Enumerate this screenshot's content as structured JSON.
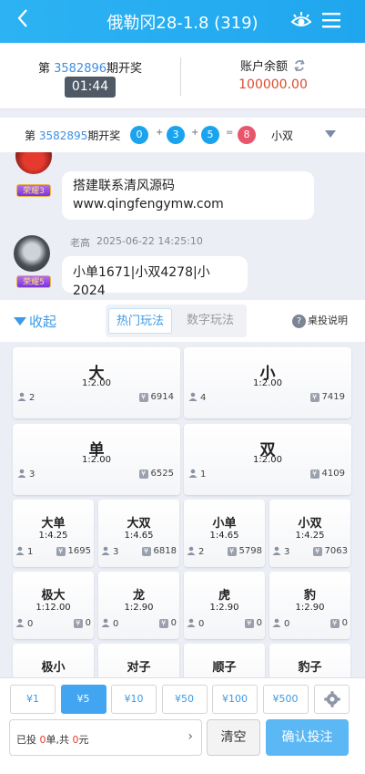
{
  "header": {
    "title": "俄勒冈28-1.8 (319)",
    "back_icon": "chevron-left-icon",
    "eye_icon": "eye-icon",
    "menu_icon": "menu-icon"
  },
  "draw": {
    "prefix": "第 ",
    "period": "3582896",
    "suffix": "期开奖",
    "countdown": "01:44",
    "balance_label": "账户余额",
    "balance": "100000.00"
  },
  "last_result": {
    "prefix": "第 ",
    "period": "3582895",
    "suffix": "期开奖",
    "balls": [
      "0",
      "3",
      "5",
      "8"
    ],
    "ball_colors": [
      "#1aa4ef",
      "#1aa4ef",
      "#1aa4ef",
      "#e8566c"
    ],
    "ops": [
      "+",
      "+",
      "="
    ],
    "kind": "小双"
  },
  "chat": {
    "messages": [
      {
        "rank": "荣耀3",
        "text_line1": "搭建联系清风源码",
        "text_line2": "www.qingfengymw.com"
      },
      {
        "user": "老高",
        "time": "2025-06-22 14:25:10",
        "rank": "荣耀5",
        "text": "小单1671|小双4278|小2024"
      }
    ]
  },
  "tabs": {
    "collapse": "收起",
    "items": [
      "热门玩法",
      "数字玩法"
    ],
    "help": "桌投说明"
  },
  "bets": [
    {
      "name": "大",
      "odds": "1:2.00",
      "players": "2",
      "amount": "6914"
    },
    {
      "name": "小",
      "odds": "1:2.00",
      "players": "4",
      "amount": "7419"
    },
    {
      "name": "单",
      "odds": "1:2.00",
      "players": "3",
      "amount": "6525"
    },
    {
      "name": "双",
      "odds": "1:2.00",
      "players": "1",
      "amount": "4109"
    },
    {
      "name": "大单",
      "odds": "1:4.25",
      "players": "1",
      "amount": "1695"
    },
    {
      "name": "大双",
      "odds": "1:4.65",
      "players": "3",
      "amount": "6818"
    },
    {
      "name": "小单",
      "odds": "1:4.65",
      "players": "2",
      "amount": "5798"
    },
    {
      "name": "小双",
      "odds": "1:4.25",
      "players": "3",
      "amount": "7063"
    },
    {
      "name": "极大",
      "odds": "1:12.00",
      "players": "0",
      "amount": "0"
    },
    {
      "name": "龙",
      "odds": "1:2.90",
      "players": "0",
      "amount": "0"
    },
    {
      "name": "虎",
      "odds": "1:2.90",
      "players": "0",
      "amount": "0"
    },
    {
      "name": "豹",
      "odds": "1:2.90",
      "players": "0",
      "amount": "0"
    },
    {
      "name": "极小",
      "odds": "",
      "players": "",
      "amount": ""
    },
    {
      "name": "对子",
      "odds": "",
      "players": "",
      "amount": ""
    },
    {
      "name": "顺子",
      "odds": "",
      "players": "",
      "amount": ""
    },
    {
      "name": "豹子",
      "odds": "",
      "players": "",
      "amount": ""
    }
  ],
  "currency_symbol": "¥",
  "chips": [
    "¥1",
    "¥5",
    "¥10",
    "¥50",
    "¥100",
    "¥500"
  ],
  "chip_selected": "¥5",
  "footer": {
    "summary_a": "已投 ",
    "bet_count": "0",
    "summary_b": "单,共 ",
    "bet_total": "0",
    "summary_c": "元",
    "clear": "清空",
    "confirm": "确认投注"
  }
}
